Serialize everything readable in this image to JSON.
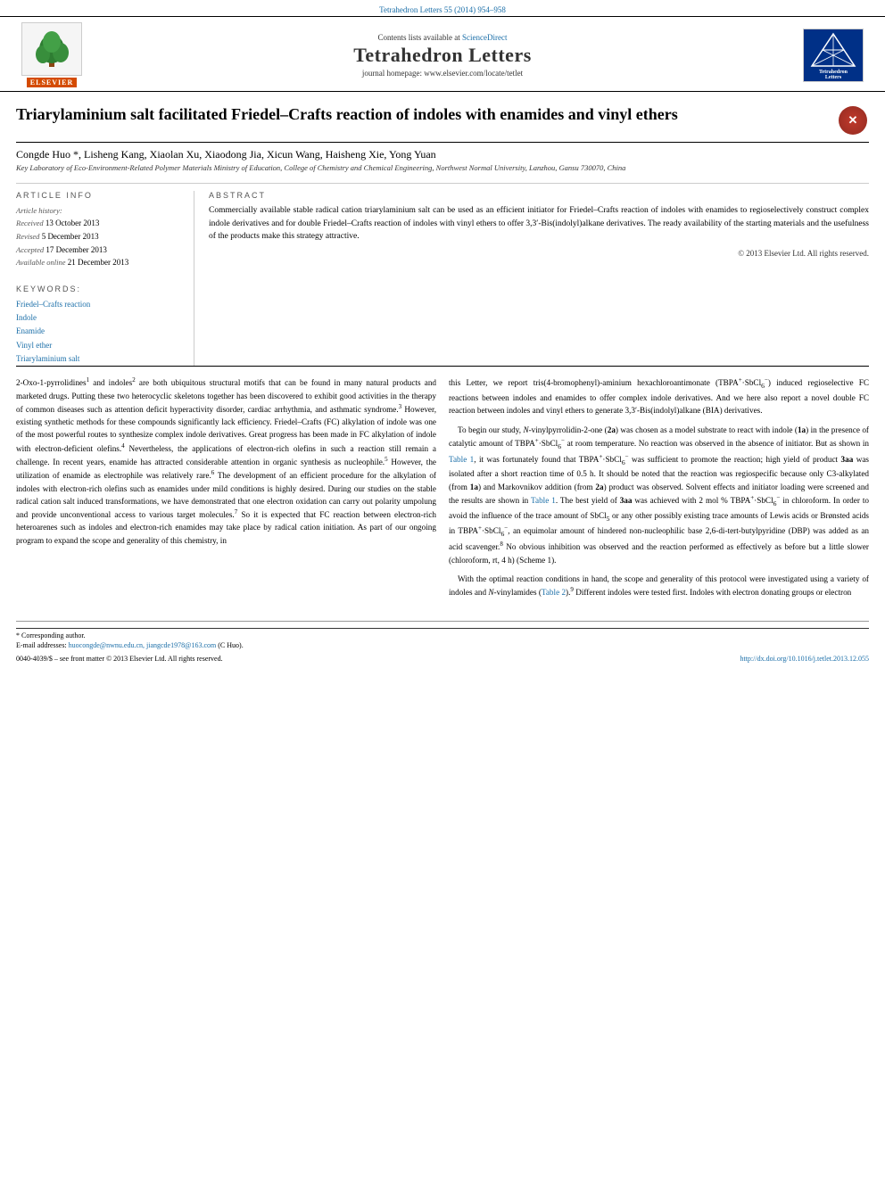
{
  "page": {
    "topbar": {
      "journal_ref": "Tetrahedron Letters 55 (2014) 954–958"
    },
    "header": {
      "contents_line": "Contents lists available at",
      "sciencedirect_link": "ScienceDirect",
      "journal_title": "Tetrahedron Letters",
      "homepage": "journal homepage: www.elsevier.com/locate/tetlet"
    },
    "article": {
      "title": "Triarylaminium salt facilitated Friedel–Crafts reaction of indoles with enamides and vinyl ethers",
      "authors": "Congde Huo *, Lisheng Kang, Xiaolan Xu, Xiaodong Jia, Xicun Wang, Haisheng Xie, Yong Yuan",
      "affiliation": "Key Laboratory of Eco-Environment-Related Polymer Materials Ministry of Education, College of Chemistry and Chemical Engineering, Northwest Normal University, Lanzhou, Gansu 730070, China",
      "article_history_label": "Article history:",
      "received_label": "Received",
      "received_date": "13 October 2013",
      "revised_label": "Revised",
      "revised_date": "5 December 2013",
      "accepted_label": "Accepted",
      "accepted_date": "17 December 2013",
      "available_label": "Available online",
      "available_date": "21 December 2013",
      "keywords_label": "Keywords:",
      "keywords": [
        "Friedel–Crafts reaction",
        "Indole",
        "Enamide",
        "Vinyl ether",
        "Triarylaminium salt"
      ],
      "abstract_heading": "ABSTRACT",
      "abstract": "Commercially available stable radical cation triarylaminium salt can be used as an efficient initiator for Friedel–Crafts reaction of indoles with enamides to regioselectively construct complex indole derivatives and for double Friedel–Crafts reaction of indoles with vinyl ethers to offer 3,3′-Bis(indolyl)alkane derivatives. The ready availability of the starting materials and the usefulness of the products make this strategy attractive.",
      "copyright": "© 2013 Elsevier Ltd. All rights reserved.",
      "article_info_heading": "ARTICLE INFO",
      "abstract_section_heading": "ABSTRACT"
    },
    "main_text": {
      "col1": {
        "paragraphs": [
          "2-Oxo-1-pyrrolidines¹ and indoles² are both ubiquitous structural motifs that can be found in many natural products and marketed drugs. Putting these two heterocyclic skeletons together has been discovered to exhibit good activities in the therapy of common diseases such as attention deficit hyperactivity disorder, cardiac arrhythmia, and asthmatic syndrome.³ However, existing synthetic methods for these compounds significantly lack efficiency. Friedel–Crafts (FC) alkylation of indole was one of the most powerful routes to synthesize complex indole derivatives. Great progress has been made in FC alkylation of indole with electron-deficient olefins.⁴ Nevertheless, the applications of electron-rich olefins in such a reaction still remain a challenge. In recent years, enamide has attracted considerable attention in organic synthesis as nucleophile.⁵ However, the utilization of enamide as electrophile was relatively rare.⁶ The development of an efficient procedure for the alkylation of indoles with electron-rich olefins such as enamides under mild conditions is highly desired. During our studies on the stable radical cation salt induced transformations, we have demonstrated that one electron oxidation can carry out polarity umpolung and provide unconventional access to various target molecules.⁷ So it is expected that FC reaction between electron-rich heteroarenes such as indoles and electron-rich enamides may take place by radical cation initiation. As part of our ongoing program to expand the scope and generality of this chemistry, in"
        ]
      },
      "col2": {
        "paragraphs": [
          "this Letter, we report tris(4-bromophenyl)-aminium hexachloroantimonate (TBPA⁺·SbCl₆⁻) induced regioselective FC reactions between indoles and enamides to offer complex indole derivatives. And we here also report a novel double FC reaction between indoles and vinyl ethers to generate 3,3′-Bis(indolyl)alkane (BIA) derivatives.",
          "To begin our study, N-vinylpyrrolidin-2-one (2a) was chosen as a model substrate to react with indole (1a) in the presence of catalytic amount of TBPA⁺·SbCl₆⁻ at room temperature. No reaction was observed in the absence of initiator. But as shown in Table 1, it was fortunately found that TBPA⁺·SbCl₆⁻ was sufficient to promote the reaction; high yield of product 3aa was isolated after a short reaction time of 0.5 h. It should be noted that the reaction was regiospecific because only C3-alkylated (from 1a) and Markovnikov addition (from 2a) product was observed. Solvent effects and initiator loading were screened and the results are shown in Table 1. The best yield of 3aa was achieved with 2 mol % TBPA⁺·SbCl₆⁻ in chloroform. In order to avoid the influence of the trace amount of SbCl₅ or any other possibly existing trace amounts of Lewis acids or Brønsted acids in TBPA⁺·SbCl₆⁻, an equimolar amount of hindered non-nucleophilic base 2,6-di-tert-butylpyridine (DBP) was added as an acid scavenger.⁸ No obvious inhibition was observed and the reaction performed as effectively as before but a little slower (chloroform, rt, 4 h) (Scheme 1).",
          "With the optimal reaction conditions in hand, the scope and generality of this protocol were investigated using a variety of indoles and N-vinylamides (Table 2).⁹ Different indoles were tested first. Indoles with electron donating groups or electron"
        ]
      }
    },
    "footer": {
      "corresponding": "* Corresponding author.",
      "email_label": "E-mail addresses:",
      "emails": "huocongde@nwnu.edu.cn, jiangcde1978@163.com",
      "email_note": "(C Huo).",
      "copyright_line": "0040-4039/$ – see front matter © 2013 Elsevier Ltd. All rights reserved.",
      "doi": "http://dx.doi.org/10.1016/j.tetlet.2013.12.055"
    },
    "table_reference": "Table"
  }
}
